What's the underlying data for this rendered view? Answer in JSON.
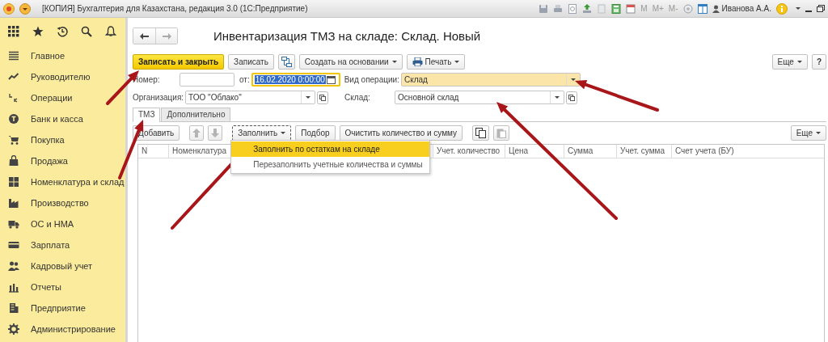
{
  "window": {
    "title": "[КОПИЯ] Бухгалтерия для Казахстана, редакция 3.0  (1С:Предприятие)",
    "memory_buttons": [
      "M",
      "M+",
      "M-"
    ],
    "user": "Иванова А.А."
  },
  "sidebar": {
    "items": [
      {
        "label": "Главное"
      },
      {
        "label": "Руководителю"
      },
      {
        "label": "Операции"
      },
      {
        "label": "Банк и касса"
      },
      {
        "label": "Покупка"
      },
      {
        "label": "Продажа"
      },
      {
        "label": "Номенклатура и склад"
      },
      {
        "label": "Производство"
      },
      {
        "label": "ОС и НМА"
      },
      {
        "label": "Зарплата"
      },
      {
        "label": "Кадровый учет"
      },
      {
        "label": "Отчеты"
      },
      {
        "label": "Предприятие"
      },
      {
        "label": "Администрирование"
      }
    ]
  },
  "form": {
    "title": "Инвентаризация ТМЗ на складе: Склад. Новый",
    "toolbar": {
      "buttons": [
        {
          "kind": "default",
          "label": "Записать и закрыть"
        },
        {
          "kind": "plain",
          "label": "Записать"
        },
        {
          "kind": "structure"
        },
        {
          "kind": "menu",
          "label": "Создать на основании"
        },
        {
          "kind": "print",
          "label": "Печать"
        }
      ],
      "more": "Еще",
      "help": "?"
    },
    "fields": {
      "number": {
        "label": "Номер:"
      },
      "date": {
        "label": "от:",
        "value": "16.02.2020  0:00:00",
        "focused": true,
        "text_selected": true
      },
      "operation": {
        "label": "Вид операции:",
        "value": "Склад",
        "highlighted": true
      },
      "organization": {
        "label": "Организация:",
        "value": "ТОО \"Облако\""
      },
      "warehouse": {
        "label": "Склад:",
        "value": "Основной склад"
      }
    },
    "tabs": [
      {
        "label": "ТМЗ",
        "selected": true
      },
      {
        "label": "Дополнительно",
        "selected": false
      }
    ],
    "table_toolbar": {
      "buttons": [
        {
          "kind": "plain",
          "label": "Добавить",
          "disabled": false
        },
        {
          "kind": "up",
          "disabled": true
        },
        {
          "kind": "down",
          "disabled": true
        },
        {
          "kind": "menu",
          "label": "Заполнить",
          "disabled": false,
          "expanded": true
        },
        {
          "kind": "plain",
          "label": "Подбор",
          "disabled": false
        },
        {
          "kind": "plain",
          "label": "Очистить количество и сумму",
          "disabled": false
        },
        {
          "kind": "copy",
          "disabled": false
        },
        {
          "kind": "paste",
          "disabled": true
        }
      ],
      "more": "Еще"
    },
    "fill_menu": {
      "items": [
        {
          "label": "Заполнить по остаткам на складе",
          "selected": true
        },
        {
          "label": "Перезаполнить учетные количества и суммы",
          "selected": false
        }
      ]
    },
    "table": {
      "columns": [
        "N",
        "Номенклатура",
        "Учет. количество",
        "Цена",
        "Сумма",
        "Учет. сумма",
        "Счет учета (БУ)"
      ]
    }
  }
}
